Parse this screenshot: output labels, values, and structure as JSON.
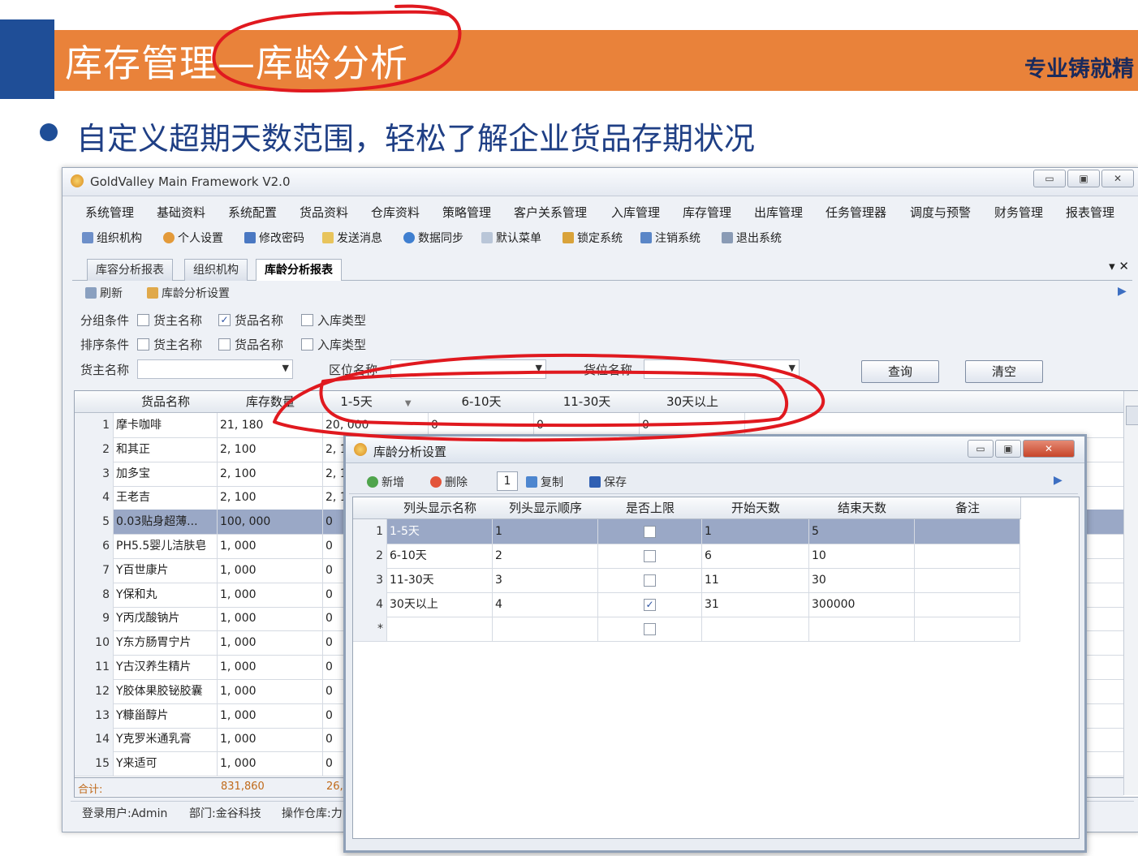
{
  "slide": {
    "title": "库存管理—库龄分析",
    "tagline": "专业铸就精",
    "bullet": "自定义超期天数范围，轻松了解企业货品存期状况"
  },
  "app": {
    "title": "GoldValley Main Framework V2.0",
    "window_buttons": [
      "▭",
      "▣",
      "✕"
    ],
    "menu": [
      "系统管理",
      "基础资料",
      "系统配置",
      "货品资料",
      "仓库资料",
      "策略管理",
      "客户关系管理",
      "入库管理",
      "库存管理",
      "出库管理",
      "任务管理器",
      "调度与预警",
      "财务管理",
      "报表管理"
    ],
    "toolbar": [
      "组织机构",
      "个人设置",
      "修改密码",
      "发送消息",
      "数据同步",
      "默认菜单",
      "锁定系统",
      "注销系统",
      "退出系统"
    ],
    "tabs": [
      "库容分析报表",
      "组织机构",
      "库龄分析报表"
    ],
    "tab_controls": "▾ ✕",
    "subtoolbar": {
      "refresh": "刷新",
      "settings": "库龄分析设置"
    },
    "filters": {
      "group_label": "分组条件",
      "sort_label": "排序条件",
      "owner_name": "货主名称",
      "goods_name": "货品名称",
      "inbound_type": "入库类型",
      "owner_label": "货主名称",
      "zone_label": "区位名称",
      "slot_label": "货位名称",
      "query_button": "查询",
      "clear_button": "清空"
    },
    "grid": {
      "headers": [
        "货品名称",
        "库存数量",
        "1-5天",
        "6-10天",
        "11-30天",
        "30天以上"
      ],
      "rows": [
        {
          "n": "1",
          "name": "摩卡咖啡",
          "qty": "21, 180",
          "a": "20, 000",
          "b": "0",
          "c": "0",
          "d": "0"
        },
        {
          "n": "2",
          "name": "和其正",
          "qty": "2, 100",
          "a": "2, 1",
          "b": "",
          "c": "",
          "d": ""
        },
        {
          "n": "3",
          "name": "加多宝",
          "qty": "2, 100",
          "a": "2, 1",
          "b": "",
          "c": "",
          "d": ""
        },
        {
          "n": "4",
          "name": "王老吉",
          "qty": "2, 100",
          "a": "2, 1",
          "b": "",
          "c": "",
          "d": ""
        },
        {
          "n": "5",
          "name": "0.03贴身超薄...",
          "qty": "100, 000",
          "a": "0",
          "b": "",
          "c": "",
          "d": ""
        },
        {
          "n": "6",
          "name": "PH5.5婴儿洁肤皂",
          "qty": "1, 000",
          "a": "0",
          "b": "",
          "c": "",
          "d": ""
        },
        {
          "n": "7",
          "name": "Y百世康片",
          "qty": "1, 000",
          "a": "0",
          "b": "",
          "c": "",
          "d": ""
        },
        {
          "n": "8",
          "name": "Y保和丸",
          "qty": "1, 000",
          "a": "0",
          "b": "",
          "c": "",
          "d": ""
        },
        {
          "n": "9",
          "name": "Y丙戊酸钠片",
          "qty": "1, 000",
          "a": "0",
          "b": "",
          "c": "",
          "d": ""
        },
        {
          "n": "10",
          "name": "Y东方肠胃宁片",
          "qty": "1, 000",
          "a": "0",
          "b": "",
          "c": "",
          "d": ""
        },
        {
          "n": "11",
          "name": "Y古汉养生精片",
          "qty": "1, 000",
          "a": "0",
          "b": "",
          "c": "",
          "d": ""
        },
        {
          "n": "12",
          "name": "Y胶体果胶铋胶囊",
          "qty": "1, 000",
          "a": "0",
          "b": "",
          "c": "",
          "d": ""
        },
        {
          "n": "13",
          "name": "Y糠甾醇片",
          "qty": "1, 000",
          "a": "0",
          "b": "",
          "c": "",
          "d": ""
        },
        {
          "n": "14",
          "name": "Y克罗米通乳膏",
          "qty": "1, 000",
          "a": "0",
          "b": "",
          "c": "",
          "d": ""
        },
        {
          "n": "15",
          "name": "Y来适可",
          "qty": "1, 000",
          "a": "0",
          "b": "",
          "c": "",
          "d": ""
        }
      ],
      "selected_row": 5,
      "total_label": "合计:",
      "total_qty": "831,860",
      "total_a": "26,"
    },
    "status": {
      "user": "登录用户:Admin",
      "dept": "部门:金谷科技",
      "warehouse": "操作仓库:力"
    }
  },
  "dialog": {
    "title": "库龄分析设置",
    "toolbar": {
      "add": "新增",
      "delete": "删除",
      "page": "1",
      "copy": "复制",
      "save": "保存"
    },
    "headers": [
      "列头显示名称",
      "列头显示顺序",
      "是否上限",
      "开始天数",
      "结束天数",
      "备注"
    ],
    "rows": [
      {
        "n": "1",
        "name": "1-5天",
        "order": "1",
        "upper": false,
        "start": "1",
        "end": "5",
        "note": ""
      },
      {
        "n": "2",
        "name": "6-10天",
        "order": "2",
        "upper": false,
        "start": "6",
        "end": "10",
        "note": ""
      },
      {
        "n": "3",
        "name": "11-30天",
        "order": "3",
        "upper": false,
        "start": "11",
        "end": "30",
        "note": ""
      },
      {
        "n": "4",
        "name": "30天以上",
        "order": "4",
        "upper": true,
        "start": "31",
        "end": "300000",
        "note": ""
      }
    ],
    "new_row_marker": "*",
    "window_buttons": [
      "▭",
      "▣",
      "✕"
    ]
  },
  "colors": {
    "banner": "#e9823a",
    "brand_blue": "#1f4e97",
    "annotation_red": "#e0191f",
    "selected_row": "#9aa8c6"
  }
}
